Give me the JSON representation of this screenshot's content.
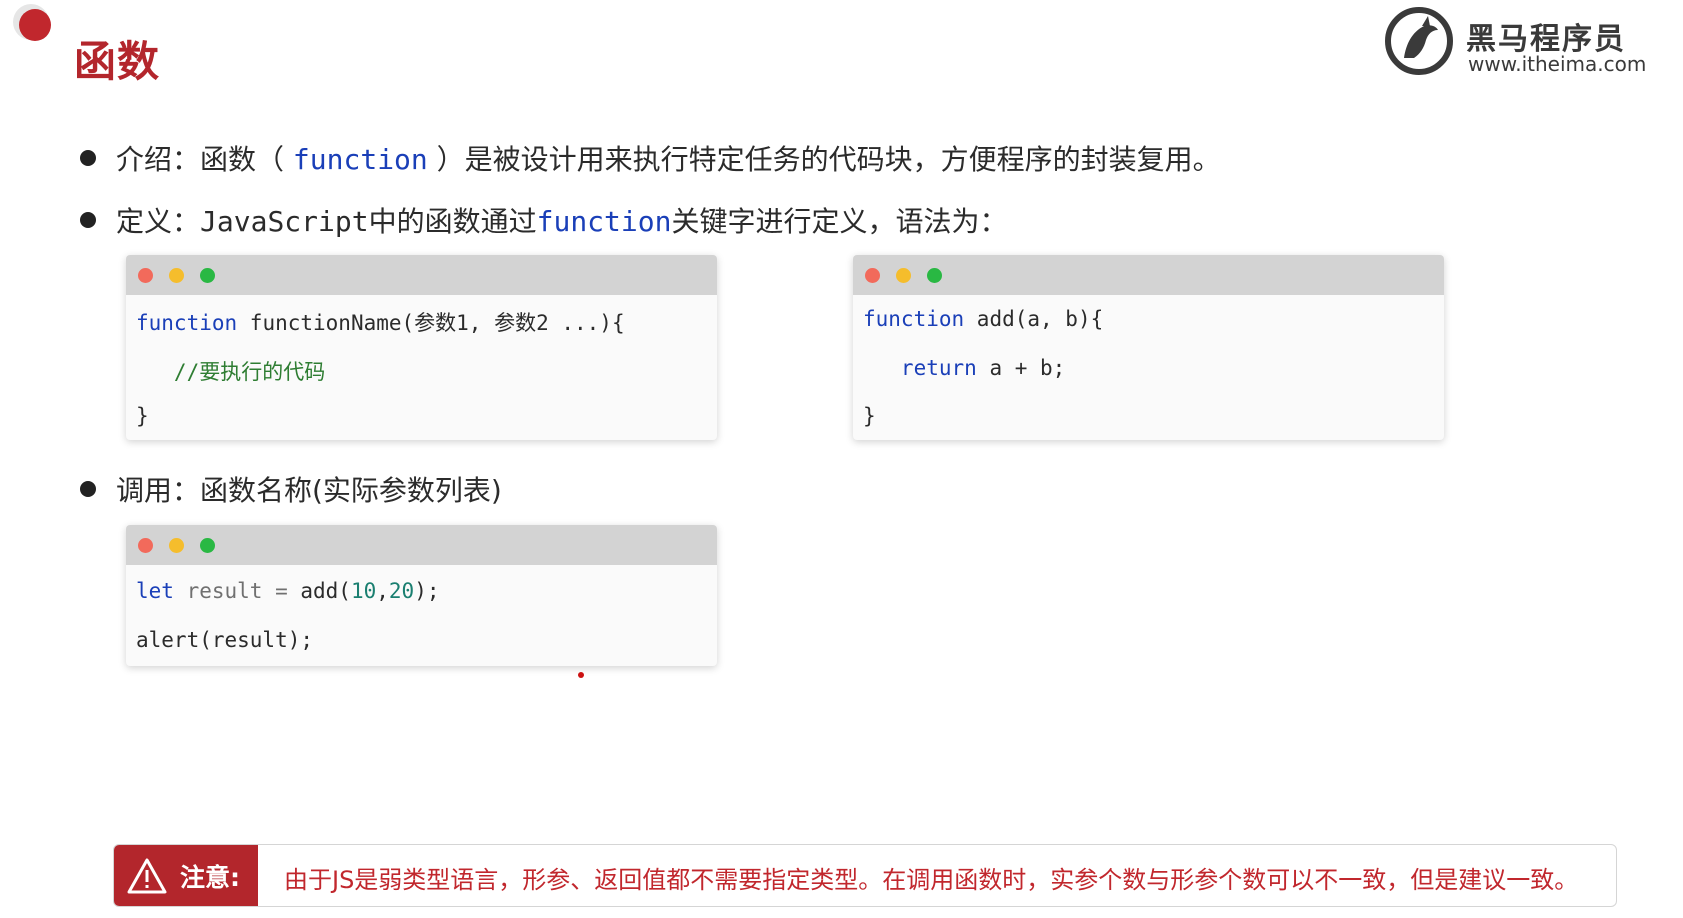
{
  "slide": {
    "title": "函数"
  },
  "logo": {
    "name": "黑马程序员",
    "url": "www.itheima.com"
  },
  "bullets": {
    "intro": {
      "prefix": "介绍：函数（ ",
      "keyword": "function",
      "suffix": " ）是被设计用来执行特定任务的代码块，方便程序的封装复用。"
    },
    "definition": {
      "prefix": "定义：",
      "mono": "JavaScript",
      "middle": "中的函数通过",
      "keyword": "function",
      "suffix": "关键字进行定义，语法为："
    },
    "call": {
      "text": "调用：函数名称(实际参数列表)"
    }
  },
  "code_syntax": {
    "line1_kw": "function",
    "line1_rest": " functionName(参数1, 参数2 ...){",
    "line2": "   //要执行的代码",
    "line3": "}"
  },
  "code_example": {
    "line1_kw": "function",
    "line1_rest": " add(a, b){",
    "line2_kw": "   return",
    "line2_rest": " a + b;",
    "line3": "}"
  },
  "code_call": {
    "line1_kw": "let",
    "line1_var": " result = ",
    "line1_fn": "add(",
    "line1_n1": "10",
    "line1_comma": ",",
    "line1_n2": "20",
    "line1_end": ");",
    "line2": "alert(result);"
  },
  "note": {
    "label": "注意:",
    "text": "由于JS是弱类型语言，形参、返回值都不需要指定类型。在调用函数时，实参个数与形参个数可以不一致，但是建议一致。"
  },
  "colors": {
    "brand_red": "#b3262c",
    "keyword_blue": "#1a3fb8",
    "comment_green": "#2e7d32",
    "code_bar": "#d3d3d3"
  }
}
